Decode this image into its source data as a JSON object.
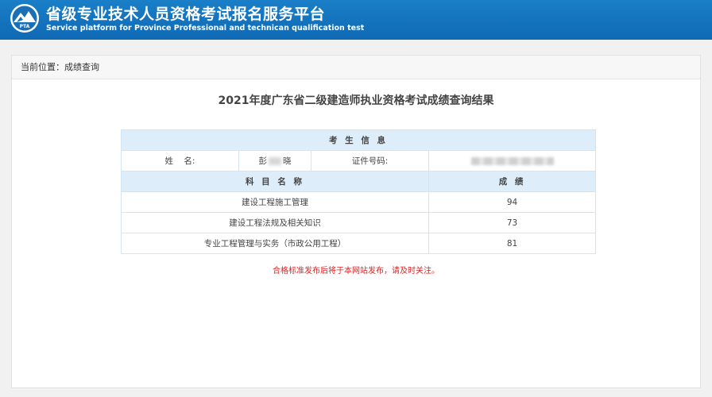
{
  "header": {
    "logo_text": "PTA",
    "title_cn": "省级专业技术人员资格考试报名服务平台",
    "title_en": "Service platform for Province Professional and technican qualification test"
  },
  "breadcrumb": "当前位置：成绩查询",
  "page_title": "2021年度广东省二级建造师执业资格考试成绩查询结果",
  "table": {
    "section_header": "考 生 信 息",
    "name_label": "姓    名:",
    "name_first": "彭",
    "name_last": "晓",
    "id_label": "证件号码:",
    "subject_header": "科 目 名 称",
    "score_header": "成 绩",
    "rows": [
      {
        "subject": "建设工程施工管理",
        "score": "94"
      },
      {
        "subject": "建设工程法规及相关知识",
        "score": "73"
      },
      {
        "subject": "专业工程管理与实务（市政公用工程）",
        "score": "81"
      }
    ]
  },
  "notice": "合格标准发布后将于本网站发布，请及时关注。",
  "colors": {
    "header_blue": "#1276c0",
    "table_header_bg": "#ddeefa",
    "notice_red": "#e02020"
  }
}
